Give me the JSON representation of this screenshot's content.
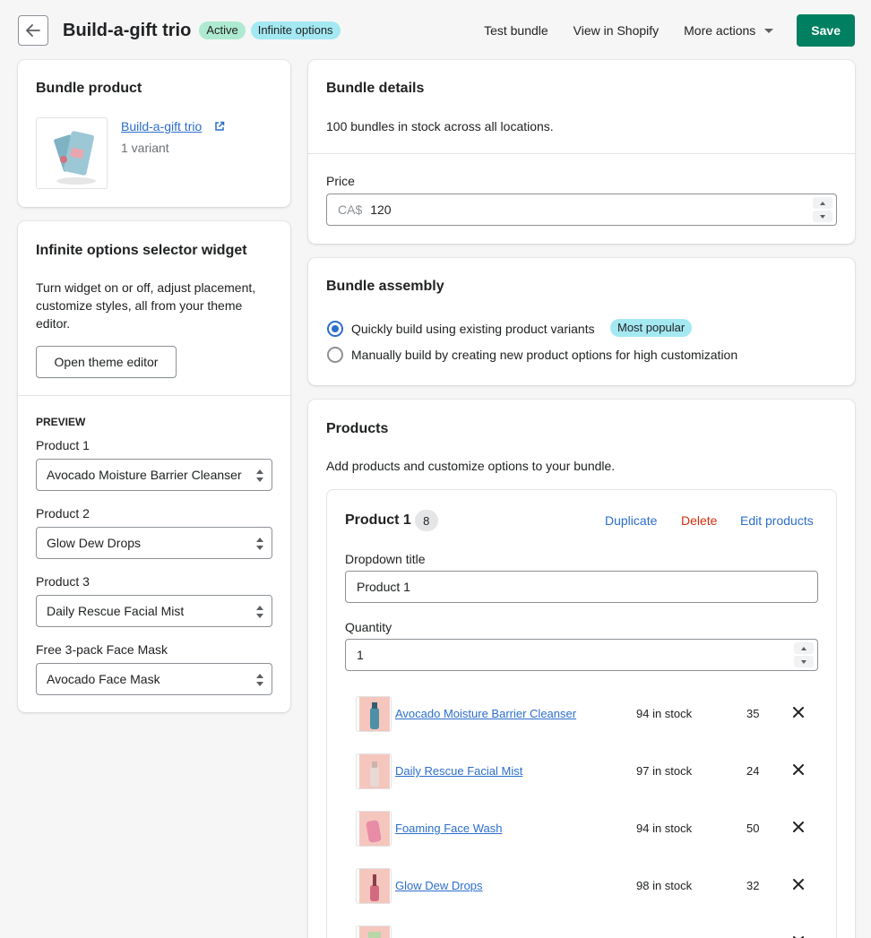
{
  "header": {
    "title": "Build-a-gift trio",
    "badges": {
      "active": "Active",
      "infinite": "Infinite options"
    },
    "test_bundle": "Test bundle",
    "view_shopify": "View in Shopify",
    "more_actions": "More actions",
    "save": "Save"
  },
  "bundle_product": {
    "title": "Bundle product",
    "product_name": "Build-a-gift trio",
    "variants": "1 variant"
  },
  "widget": {
    "title": "Infinite options selector widget",
    "description": "Turn widget on or off, adjust placement, customize styles, all from your theme editor.",
    "open_editor": "Open theme editor",
    "preview_heading": "PREVIEW",
    "selectors": [
      {
        "label": "Product 1",
        "value": "Avocado Moisture Barrier Cleanser"
      },
      {
        "label": "Product 2",
        "value": "Glow Dew Drops"
      },
      {
        "label": "Product 3",
        "value": "Daily Rescue Facial Mist"
      },
      {
        "label": "Free 3-pack Face Mask",
        "value": "Avocado Face Mask"
      }
    ]
  },
  "bundle_details": {
    "title": "Bundle details",
    "stock_text": "100 bundles in stock across all locations.",
    "price_label": "Price",
    "price_prefix": "CA$",
    "price_value": "120"
  },
  "assembly": {
    "title": "Bundle assembly",
    "option_quick": "Quickly build using existing product variants",
    "popular_badge": "Most popular",
    "option_manual": "Manually build by creating new product options for high customization",
    "selected": "quick"
  },
  "products": {
    "title": "Products",
    "description": "Add products and customize options to your bundle.",
    "product_card": {
      "title": "Product 1",
      "count": "8",
      "duplicate": "Duplicate",
      "delete": "Delete",
      "edit": "Edit products",
      "dropdown_title_label": "Dropdown title",
      "dropdown_title_value": "Product 1",
      "quantity_label": "Quantity",
      "quantity_value": "1",
      "items": [
        {
          "name": "Avocado Moisture Barrier Cleanser",
          "stock": "94 in stock",
          "qty": "35"
        },
        {
          "name": "Daily Rescue Facial Mist",
          "stock": "97 in stock",
          "qty": "24"
        },
        {
          "name": "Foaming Face Wash",
          "stock": "94 in stock",
          "qty": "50"
        },
        {
          "name": "Glow Dew Drops",
          "stock": "98 in stock",
          "qty": "32"
        }
      ]
    }
  },
  "colors": {
    "primary": "#008060",
    "link": "#2c6ecb",
    "critical": "#d72c0d",
    "badge_success": "#aee9d1",
    "badge_info": "#a4e8f2",
    "page_bg": "#f6f6f7"
  }
}
